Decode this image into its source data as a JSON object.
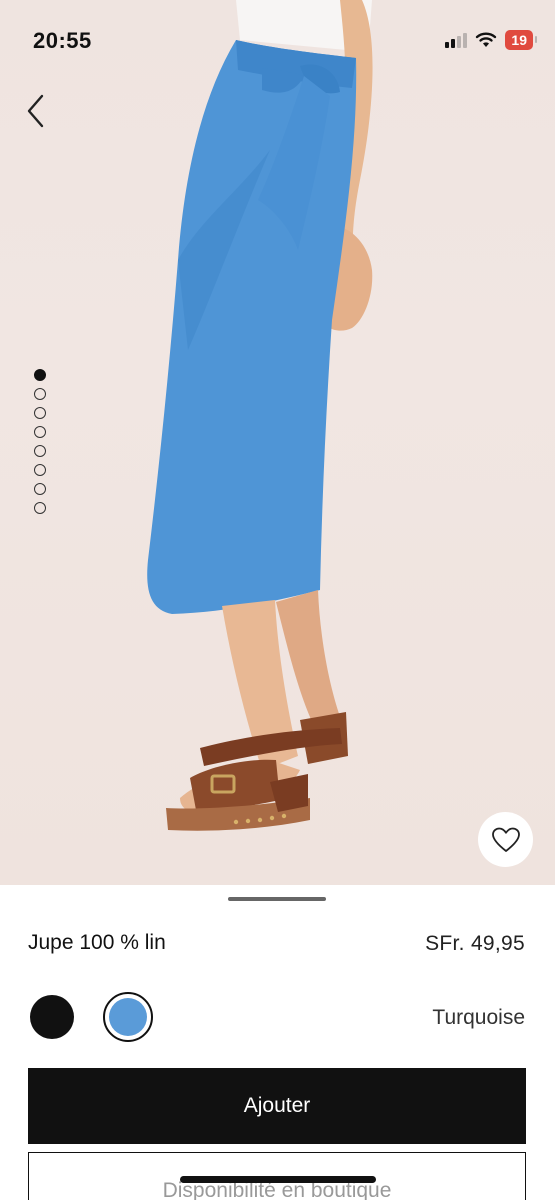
{
  "status_bar": {
    "time": "20:55",
    "battery": "19"
  },
  "gallery": {
    "image_count": 8,
    "active_index": 0
  },
  "product": {
    "name": "Jupe 100 % lin",
    "price": "SFr. 49,95"
  },
  "colors": {
    "options": [
      {
        "name": "black",
        "hex": "#111111"
      },
      {
        "name": "Turquoise",
        "hex": "#5a9bd8"
      }
    ],
    "selected_label": "Turquoise"
  },
  "actions": {
    "add_label": "Ajouter",
    "store_label": "Disponibilité en boutique"
  },
  "icons": {
    "back": "chevron-left-icon",
    "favorite": "heart-icon",
    "signal": "cellular-signal-icon",
    "wifi": "wifi-icon"
  }
}
